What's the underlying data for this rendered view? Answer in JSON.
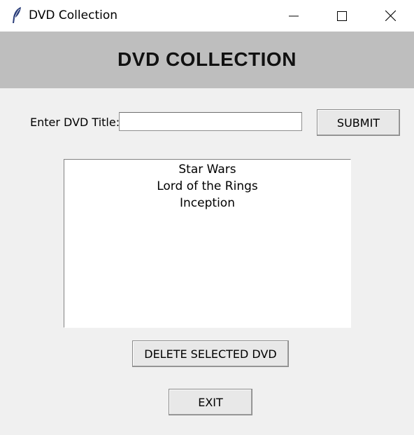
{
  "window": {
    "title": "DVD Collection",
    "icon": "feather-icon",
    "controls": [
      "minimize-icon",
      "maximize-icon",
      "close-icon"
    ]
  },
  "header": {
    "title": "DVD COLLECTION"
  },
  "form": {
    "label": "Enter DVD Title:",
    "input_value": "",
    "submit_label": "SUBMIT"
  },
  "list": {
    "items": [
      "Star Wars",
      "Lord of the Rings",
      "Inception"
    ]
  },
  "actions": {
    "delete_label": "DELETE SELECTED DVD",
    "exit_label": "EXIT"
  },
  "colors": {
    "window_bg": "#f0f0f0",
    "banner_bg": "#bebebe",
    "titlebar_bg": "#ffffff"
  }
}
